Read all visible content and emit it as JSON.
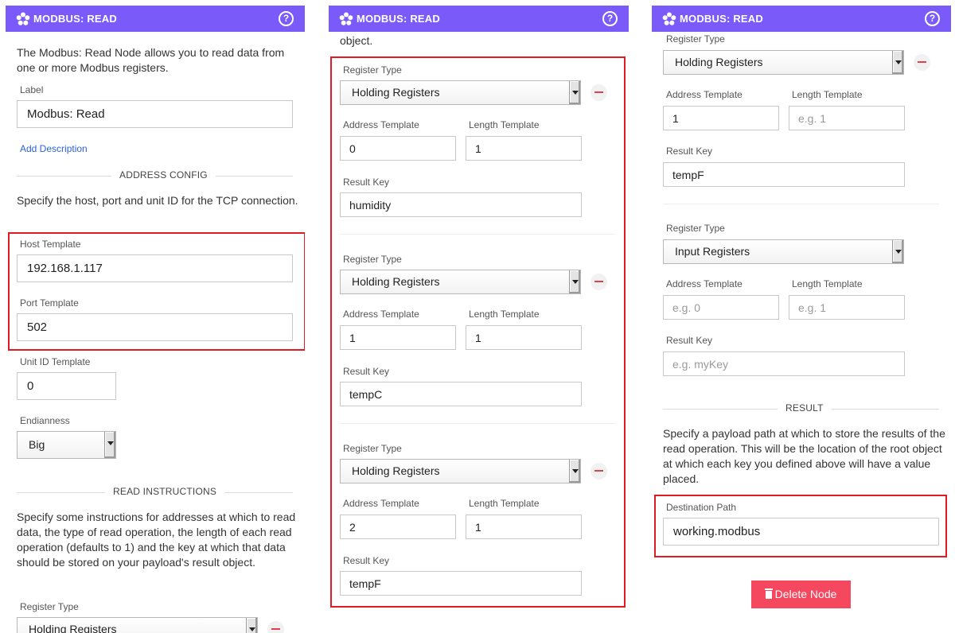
{
  "header": {
    "title": "MODBUS: READ",
    "help_icon": "?"
  },
  "panel1": {
    "intro": "The Modbus: Read Node allows you to read data from one or more Modbus registers.",
    "label_label": "Label",
    "label_value": "Modbus: Read",
    "add_description": "Add Description",
    "address_config_title": "ADDRESS CONFIG",
    "address_config_text": "Specify the host, port and unit ID for the TCP connection.",
    "host_label": "Host Template",
    "host_value": "192.168.1.117",
    "port_label": "Port Template",
    "port_value": "502",
    "unit_label": "Unit ID Template",
    "unit_value": "0",
    "endianness_label": "Endianness",
    "endianness_value": "Big",
    "read_instructions_title": "READ INSTRUCTIONS",
    "read_instructions_text": "Specify some instructions for addresses at which to read data, the type of read operation, the length of each read operation (defaults to 1) and the key at which that data should be stored on your payload's result object.",
    "register_type_label": "Register Type",
    "register_type_value": "Holding Registers"
  },
  "panel2": {
    "top_text": "object.",
    "instructions": [
      {
        "register_type_label": "Register Type",
        "register_type": "Holding Registers",
        "address_label": "Address Template",
        "address": "0",
        "length_label": "Length Template",
        "length": "1",
        "result_key_label": "Result Key",
        "result_key": "humidity"
      },
      {
        "register_type_label": "Register Type",
        "register_type": "Holding Registers",
        "address_label": "Address Template",
        "address": "1",
        "length_label": "Length Template",
        "length": "1",
        "result_key_label": "Result Key",
        "result_key": "tempC"
      },
      {
        "register_type_label": "Register Type",
        "register_type": "Holding Registers",
        "address_label": "Address Template",
        "address": "2",
        "length_label": "Length Template",
        "length": "1",
        "result_key_label": "Result Key",
        "result_key": "tempF"
      }
    ]
  },
  "panel3": {
    "instructions": [
      {
        "register_type_label": "Register Type",
        "register_type": "Holding Registers",
        "address_label": "Address Template",
        "address": "1",
        "length_label": "Length Template",
        "length_placeholder": "e.g. 1",
        "result_key_label": "Result Key",
        "result_key": "tempF"
      },
      {
        "register_type_label": "Register Type",
        "register_type": "Input Registers",
        "address_label": "Address Template",
        "address_placeholder": "e.g. 0",
        "length_label": "Length Template",
        "length_placeholder": "e.g. 1",
        "result_key_label": "Result Key",
        "result_key_placeholder": "e.g. myKey"
      }
    ],
    "result_title": "RESULT",
    "result_text": "Specify a payload path at which to store the results of the read operation. This will be the location of the root object at which each key you defined above will have a value placed.",
    "destination_label": "Destination Path",
    "destination_value": "working.modbus",
    "delete_button": "Delete Node"
  },
  "colors": {
    "header": "#7a5af8",
    "highlight_box": "#e01b24",
    "delete_button": "#f5475d",
    "link": "#2a62d8",
    "remove_icon": "#e0424d"
  },
  "icons": {
    "logo": "flower-logo-icon",
    "help": "help-circle-icon",
    "remove": "minus-circle-icon",
    "trash": "trash-icon",
    "dropdown": "chevron-down-icon"
  }
}
